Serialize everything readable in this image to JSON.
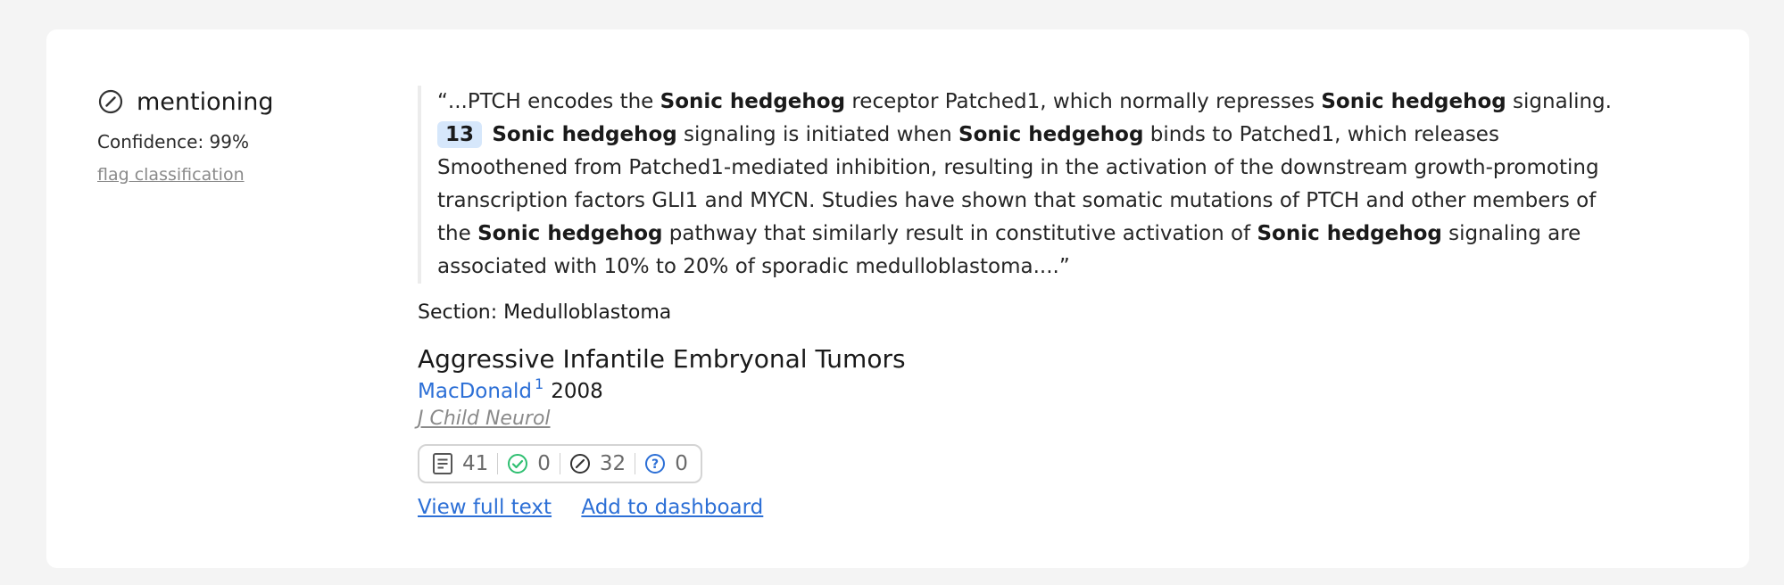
{
  "tally": {
    "icon": "mentioning-icon",
    "label": "mentioning",
    "confidence": "Confidence: 99%",
    "flag_label": "flag classification"
  },
  "snippet": {
    "open_quote": "“",
    "close_quote": "”",
    "citation_number": "13",
    "before": {
      "t1": "...PTCH encodes the ",
      "b1": "Sonic hedgehog",
      "t2": " receptor Patched1, which normally represses ",
      "b2": "Sonic hedgehog",
      "t3": " signaling. "
    },
    "after": {
      "b1": "Sonic hedgehog",
      "t1": " signaling is initiated when ",
      "b2": "Sonic hedgehog",
      "t2": " binds to Patched1, which releases Smoothened from Patched1-mediated inhibition, resulting in the activation of the downstream growth-promoting transcription factors GLI1 and MYCN. Studies have shown that somatic mutations of PTCH and other members of the ",
      "b3": "Sonic hedgehog",
      "t3": " pathway that similarly result in constitutive activation of ",
      "b4": "Sonic hedgehog",
      "t4": " signaling are associated with 10% to 20% of sporadic medulloblastoma...."
    },
    "section": "Section: Medulloblastoma"
  },
  "paper": {
    "title": "Aggressive Infantile Embryonal Tumors",
    "author": "MacDonald",
    "author_sup": "1",
    "year": "2008",
    "journal": "J Child Neurol"
  },
  "stats": {
    "publications": "41",
    "supporting": "0",
    "mentioning": "32",
    "contrasting": "0",
    "colors": {
      "publications": "#555555",
      "supporting": "#2fbf71",
      "mentioning": "#333333",
      "contrasting": "#2c6fd6"
    }
  },
  "actions": {
    "view_full_text": "View full text",
    "add_to_dashboard": "Add to dashboard"
  },
  "colors": {
    "link": "#2c6fd6",
    "badge_bg": "#d6e7fb",
    "page_bg": "#f4f4f4",
    "card_bg": "#ffffff"
  }
}
